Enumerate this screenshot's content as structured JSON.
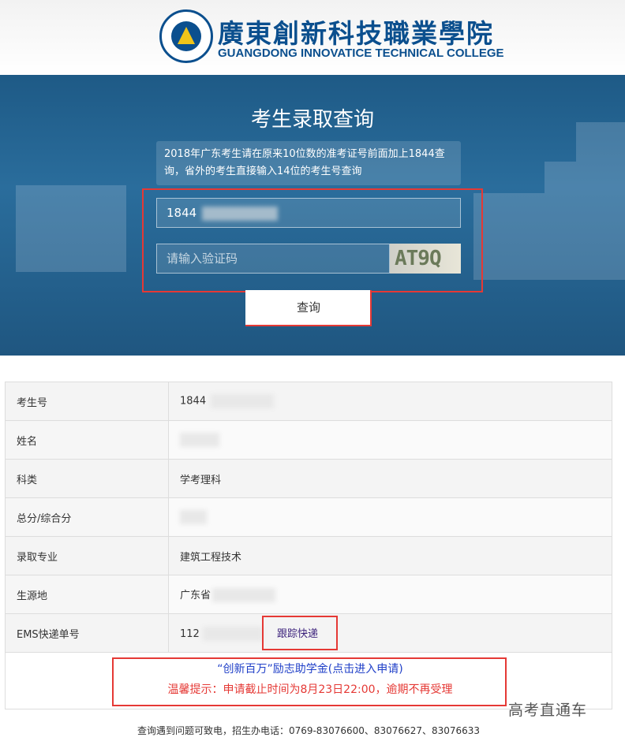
{
  "header": {
    "college_cn": "廣東創新科技職業學院",
    "college_en": "GUANGDONG INNOVATICE TECHNICAL COLLEGE",
    "logo_icon": "college-emblem-icon"
  },
  "search": {
    "title": "考生录取查询",
    "notice": "2018年广东考生请在原来10位数的准考证号前面加上1844查询，省外的考生直接输入14位的考生号查询",
    "exam_id_value": "1844",
    "captcha_placeholder": "请输入验证码",
    "captcha_text": "AT9Q",
    "query_button": "查询"
  },
  "results": {
    "rows": [
      {
        "label": "考生号",
        "value": "1844"
      },
      {
        "label": "姓名",
        "value": ""
      },
      {
        "label": "科类",
        "value": "学考理科"
      },
      {
        "label": "总分/综合分",
        "value": ""
      },
      {
        "label": "录取专业",
        "value": "建筑工程技术"
      },
      {
        "label": "生源地",
        "value": "广东省"
      },
      {
        "label": "EMS快递单号",
        "value": "112"
      }
    ],
    "track_link": "跟踪快递"
  },
  "promo": {
    "link": "“创新百万”励志助学金(点击进入申请)",
    "tip": "温馨提示：申请截止时间为8月23日22:00，逾期不再受理"
  },
  "footer": {
    "contact": "查询遇到问题可致电，招生办电话：0769-83076600、83076627、83076633"
  },
  "watermark": "高考直通车",
  "colors": {
    "brand_blue": "#0b4f8e",
    "highlight_red": "#e53935",
    "link_blue": "#2040c8"
  }
}
